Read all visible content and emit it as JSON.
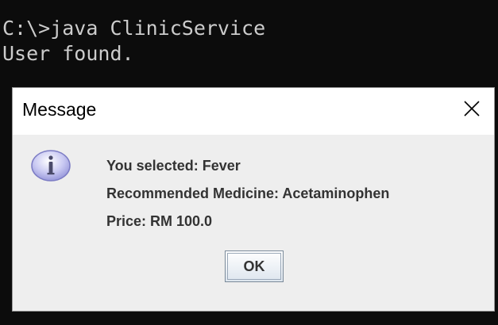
{
  "console": {
    "lines": [
      "C:\\>java ClinicService",
      "User found."
    ]
  },
  "dialog": {
    "title": "Message",
    "message_lines": [
      "You selected: Fever",
      "Recommended Medicine: Acetaminophen",
      "Price: RM 100.0"
    ],
    "ok_label": "OK",
    "icon": "info-icon",
    "close_icon": "close-icon"
  },
  "colors": {
    "console_bg": "#0c0c0c",
    "console_text": "#cccccc",
    "dialog_bg": "#eeeeee",
    "titlebar_bg": "#ffffff",
    "message_text": "#333333"
  }
}
